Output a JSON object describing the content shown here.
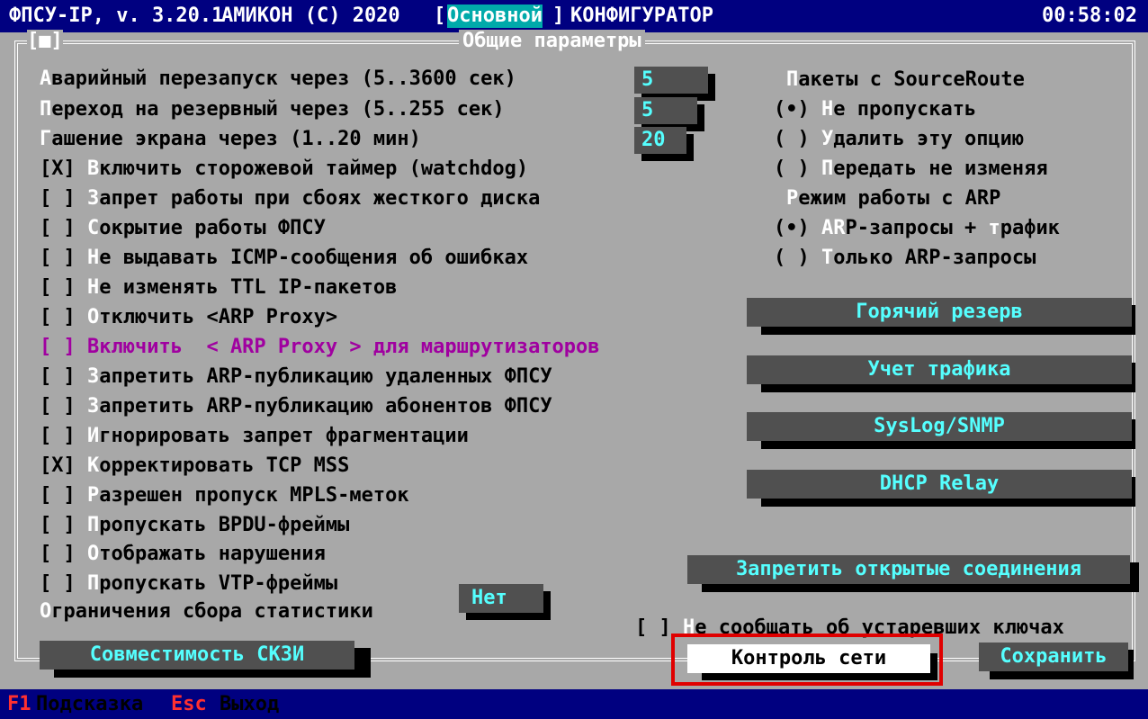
{
  "titlebar": {
    "app": "ФПСУ-IP, v. 3.20.1",
    "vendor": "АМИКОН (C) 2020",
    "bracket_open": "[",
    "mode": "Основной",
    "bracket_close": "]",
    "configurator": "КОНФИГУРАТОР",
    "time": "00:58:02"
  },
  "frame": {
    "marker": "[■]",
    "title": "Общие параметры"
  },
  "fields": [
    {
      "hot": "А",
      "rest": "варийный перезапуск через (5..3600 сек)",
      "value": "5"
    },
    {
      "hot": "П",
      "rest": "ереход на резервный через (5..255 сек)",
      "value": "5"
    },
    {
      "hot": "Г",
      "rest": "ашение экрана через (1..20 мин)",
      "value": "20"
    }
  ],
  "checkboxes": [
    {
      "box": "[X]",
      "hot": "В",
      "rest": "ключить сторожевой таймер (watchdog)",
      "highlight": false
    },
    {
      "box": "[ ]",
      "hot": "З",
      "rest": "апрет работы при сбоях жесткого диска",
      "highlight": false
    },
    {
      "box": "[ ]",
      "hot": "С",
      "rest": "окрытие работы ФПСУ",
      "highlight": false
    },
    {
      "box": "[ ]",
      "hot": "Н",
      "rest": "е выдавать ICMP-сообщения об ошибках",
      "highlight": false
    },
    {
      "box": "[ ]",
      "hot": "Н",
      "rest": "е изменять TTL IP-пакетов",
      "highlight": false
    },
    {
      "box": "[ ]",
      "hot": "О",
      "rest": "тключить <ARP Proxy>",
      "highlight": false
    },
    {
      "box": "[ ]",
      "hot": "",
      "rest": "Включить  < ARP Proxy > для маршрутизаторов",
      "highlight": true
    },
    {
      "box": "[ ]",
      "hot": "З",
      "rest": "апретить ARP-публикацию удаленных ФПСУ",
      "highlight": false
    },
    {
      "box": "[ ]",
      "hot": "З",
      "rest": "апретить ARP-публикацию абонентов ФПСУ",
      "highlight": false
    },
    {
      "box": "[ ]",
      "hot": "И",
      "rest": "гнорировать запрет фрагментации",
      "highlight": false
    },
    {
      "box": "[X]",
      "hot": "К",
      "rest": "орректировать TCP MSS",
      "highlight": false
    },
    {
      "box": "[ ]",
      "hot": "Р",
      "rest": "азрешен пропуск MPLS-меток",
      "highlight": false
    },
    {
      "box": "[ ]",
      "hot": "П",
      "rest": "ропускать BPDU-фреймы",
      "highlight": false
    },
    {
      "box": "[ ]",
      "hot": "О",
      "rest": "тображать нарушения",
      "highlight": false
    },
    {
      "box": "[ ]",
      "hot": "П",
      "rest": "ропускать VTP-фреймы",
      "highlight": false
    }
  ],
  "stats_limit": {
    "hot": "О",
    "rest": "граничения сбора статистики",
    "value": "Нет"
  },
  "source_route": {
    "hot": "П",
    "rest": "акеты с SourceRoute",
    "options": [
      {
        "mark": "(•)",
        "hot": "Н",
        "rest": "е пропускать"
      },
      {
        "mark": "( )",
        "hot": "У",
        "rest": "далить эту опцию"
      },
      {
        "mark": "( )",
        "hot": "П",
        "rest": "ередать не изменяя"
      }
    ]
  },
  "arp_mode": {
    "hot": "Р",
    "rest": "ежим работы с ARP",
    "options": [
      {
        "mark": "(•)",
        "hot": "AR",
        "rest": "P-запросы + ",
        "hot2": "т",
        "rest2": "рафик"
      },
      {
        "mark": "( )",
        "hot": "Т",
        "rest": "олько ARP-запросы"
      }
    ]
  },
  "buttons": {
    "hot_reserve": "Горячий резерв",
    "traffic": "Учет трафика",
    "syslog": "SysLog/SNMP",
    "dhcp": "DHCP Relay",
    "deny_open": "Запретить открытые соединения",
    "compat": "Совместимость СКЗИ",
    "network": "Контроль сети",
    "save": "Сохранить"
  },
  "stale_keys": {
    "box": "[ ]",
    "hot": "Н",
    "rest": "е сообщать об устаревших ключах"
  },
  "help": {
    "f1_key": "F1",
    "f1_label": "Подсказка",
    "esc_key": "Esc",
    "esc_label": "Выход"
  },
  "colors": {
    "background": "#a8a8a8",
    "bar": "#000080",
    "field": "#505050",
    "field_text": "#55ffff",
    "highlight_border": "#e00000",
    "magenta": "#a000a0"
  }
}
